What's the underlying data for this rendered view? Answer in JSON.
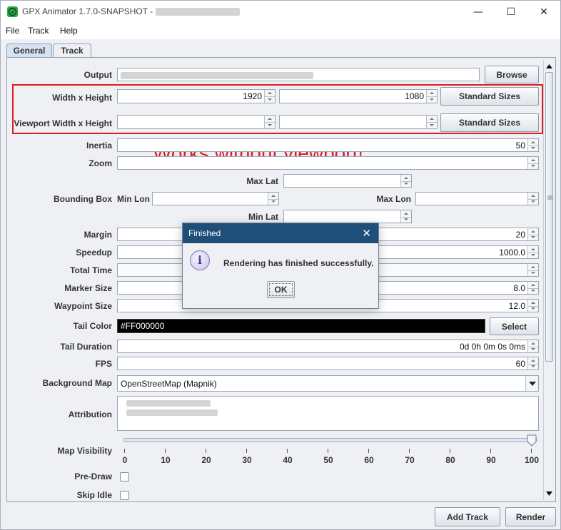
{
  "window": {
    "title": "GPX Animator 1.7.0-SNAPSHOT - ",
    "minimize_glyph": "—",
    "maximize_glyph": "☐",
    "close_glyph": "✕"
  },
  "menu": {
    "items": [
      "File",
      "Track",
      "Help"
    ]
  },
  "tabs": [
    {
      "label": "General",
      "selected": true
    },
    {
      "label": "Track",
      "selected": false
    }
  ],
  "form": {
    "output": {
      "label": "Output",
      "button": "Browse"
    },
    "width_height": {
      "label": "Width x Height",
      "width": "1920",
      "height": "1080",
      "button": "Standard Sizes"
    },
    "viewport": {
      "label": "Viewport Width x Height",
      "width": "",
      "height": "",
      "button": "Standard Sizes"
    },
    "inertia": {
      "label": "Inertia",
      "value": "50"
    },
    "zoom": {
      "label": "Zoom",
      "value": ""
    },
    "bounding_box": {
      "label": "Bounding Box",
      "max_lat": "Max Lat",
      "min_lon": "Min Lon",
      "max_lon": "Max Lon",
      "min_lat": "Min Lat"
    },
    "margin": {
      "label": "Margin",
      "value": "20"
    },
    "speedup": {
      "label": "Speedup",
      "value": "1000.0"
    },
    "total_time": {
      "label": "Total Time",
      "value": ""
    },
    "marker_size": {
      "label": "Marker Size",
      "value": "8.0"
    },
    "waypoint_size": {
      "label": "Waypoint Size",
      "value": "12.0"
    },
    "tail_color": {
      "label": "Tail Color",
      "value": "#FF000000",
      "swatch": "#000000",
      "button": "Select"
    },
    "tail_duration": {
      "label": "Tail Duration",
      "value": "0d 0h 0m 0s 0ms"
    },
    "fps": {
      "label": "FPS",
      "value": "60"
    },
    "background_map": {
      "label": "Background Map",
      "value": "OpenStreetMap (Mapnik)"
    },
    "attribution": {
      "label": "Attribution"
    },
    "map_visibility": {
      "label": "Map Visibility",
      "value": 100,
      "ticks": [
        "0",
        "10",
        "20",
        "30",
        "40",
        "50",
        "60",
        "70",
        "80",
        "90",
        "100"
      ]
    },
    "pre_draw": {
      "label": "Pre-Draw",
      "checked": false
    },
    "skip_idle": {
      "label": "Skip Idle",
      "checked": false
    }
  },
  "annotation": {
    "text": "Works without viewport!",
    "color": "#e01b24"
  },
  "dialog": {
    "title": "Finished",
    "message": "Rendering has finished successfully.",
    "ok": "OK",
    "close_glyph": "✕",
    "info_glyph": "i"
  },
  "footer": {
    "add_track": "Add Track",
    "render": "Render"
  }
}
